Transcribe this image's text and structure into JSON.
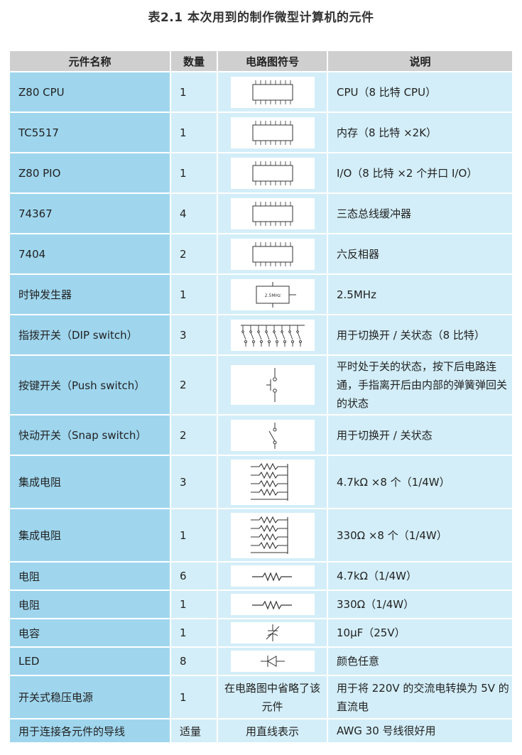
{
  "title": "表2.1 本次用到的制作微型计算机的元件",
  "headers": {
    "name": "元件名称",
    "qty": "数量",
    "symbol": "电路图符号",
    "desc": "说明"
  },
  "rows": [
    {
      "name": "Z80 CPU",
      "qty": "1",
      "symbol_icon": "ic-chip-icon",
      "desc": "CPU（8 比特 CPU）"
    },
    {
      "name": "TC5517",
      "qty": "1",
      "symbol_icon": "ic-chip-icon",
      "desc": "内存（8 比特 ×2K）"
    },
    {
      "name": "Z80 PIO",
      "qty": "1",
      "symbol_icon": "ic-chip-icon",
      "desc": "I/O（8 比特 ×2 个并口 I/O）"
    },
    {
      "name": "74367",
      "qty": "4",
      "symbol_icon": "ic-chip-icon",
      "desc": "三态总线缓冲器"
    },
    {
      "name": "7404",
      "qty": "2",
      "symbol_icon": "ic-chip-icon",
      "desc": "六反相器"
    },
    {
      "name": "时钟发生器",
      "qty": "1",
      "symbol_icon": "oscillator-icon",
      "symbol_label": "2.5MHz",
      "desc": "2.5MHz"
    },
    {
      "name": "指拨开关（DIP switch）",
      "qty": "3",
      "symbol_icon": "dip-switch-icon",
      "desc": "用于切换开 / 关状态（8 比特）"
    },
    {
      "name": "按键开关（Push switch）",
      "qty": "2",
      "symbol_icon": "push-switch-icon",
      "desc": "平时处于关的状态，按下后电路连通，手指离开后由内部的弹簧弹回关的状态"
    },
    {
      "name": "快动开关（Snap switch）",
      "qty": "2",
      "symbol_icon": "snap-switch-icon",
      "desc": "用于切换开 / 关状态"
    },
    {
      "name": "集成电阻",
      "qty": "3",
      "symbol_icon": "resistor-network-icon",
      "desc": "4.7kΩ ×8 个（1/4W）"
    },
    {
      "name": "集成电阻",
      "qty": "1",
      "symbol_icon": "resistor-network-icon",
      "desc": "330Ω ×8 个（1/4W）"
    },
    {
      "name": "电阻",
      "qty": "6",
      "symbol_icon": "resistor-icon",
      "desc": "4.7kΩ（1/4W）"
    },
    {
      "name": "电阻",
      "qty": "1",
      "symbol_icon": "resistor-icon",
      "desc": "330Ω（1/4W）"
    },
    {
      "name": "电容",
      "qty": "1",
      "symbol_icon": "capacitor-icon",
      "desc": "10μF（25V）"
    },
    {
      "name": "LED",
      "qty": "8",
      "symbol_icon": "led-diode-icon",
      "desc": "颜色任意"
    },
    {
      "name": "开关式稳压电源",
      "qty": "1",
      "symbol_text": "在电路图中省略了该元件",
      "desc": "用于将 220V 的交流电转换为 5V 的直流电"
    },
    {
      "name": "用于连接各元件的导线",
      "qty": "适量",
      "symbol_text": "用直线表示",
      "desc": "AWG 30 号线很好用"
    }
  ],
  "colors": {
    "header_bg": "#cfcfcf",
    "name_col_bg": "#9fd6ee",
    "cell_bg": "#d3eef8"
  }
}
